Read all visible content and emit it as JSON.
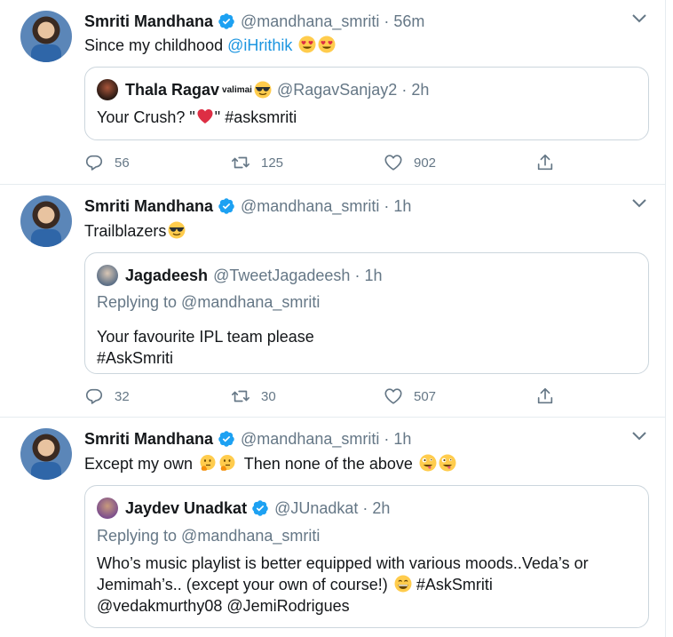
{
  "tweets": [
    {
      "author": {
        "name": "Smriti Mandhana",
        "handle": "@mandhana_smriti"
      },
      "time": "56m",
      "text": "Since my childhood ",
      "mention": "@iHrithik",
      "quoted": {
        "name": "Thala Ragav",
        "name_suffix": "valimai",
        "handle": "@RagavSanjay2",
        "time": "2h",
        "text_before": "Your Crush? \"",
        "text_after": "\" #asksmriti"
      },
      "counts": {
        "replies": "56",
        "retweets": "125",
        "likes": "902"
      }
    },
    {
      "author": {
        "name": "Smriti Mandhana",
        "handle": "@mandhana_smriti"
      },
      "time": "1h",
      "text": "Trailblazers",
      "quoted": {
        "name": "Jagadeesh",
        "handle": "@TweetJagadeesh",
        "time": "1h",
        "replying_to": "Replying to @mandhana_smriti",
        "line1": "Your favourite IPL team please",
        "line2": "#AskSmriti"
      },
      "counts": {
        "replies": "32",
        "retweets": "30",
        "likes": "507"
      }
    },
    {
      "author": {
        "name": "Smriti Mandhana",
        "handle": "@mandhana_smriti"
      },
      "time": "1h",
      "text_part1": "Except my own ",
      "text_part2": " Then none of the above ",
      "quoted": {
        "name": "Jaydev Unadkat",
        "handle": "@JUnadkat",
        "time": "2h",
        "replying_to": "Replying to @mandhana_smriti",
        "line1": "Who’s music playlist is better equipped with various moods..Veda’s or",
        "line2_before": "Jemimah’s.. (except your own of course!) ",
        "line2_after": " #AskSmriti",
        "line3": "@vedakmurthy08 @JemiRodrigues"
      }
    }
  ],
  "icons": {
    "verified": "verified-badge-icon",
    "reply": "reply-icon",
    "retweet": "retweet-icon",
    "like": "heart-icon",
    "share": "share-icon",
    "caret": "chevron-down-icon"
  },
  "colors": {
    "link": "#1b95e0",
    "muted": "#657786",
    "border": "#ccd6dd",
    "verified": "#1da1f2"
  }
}
